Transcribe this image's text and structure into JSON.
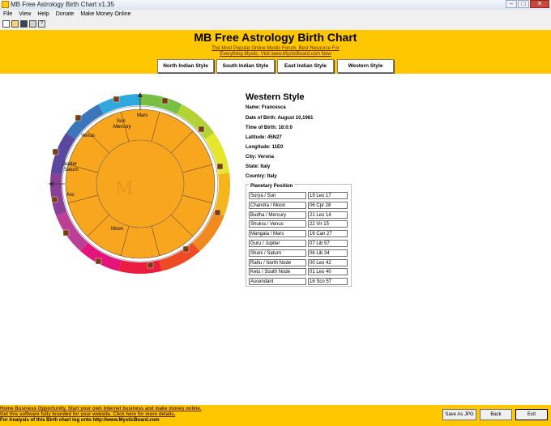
{
  "window": {
    "title": "MB Free Astrology Birth Chart v1.35"
  },
  "menu": [
    "File",
    "View",
    "Help",
    "Donate",
    "Make Money Online"
  ],
  "header": {
    "title": "MB Free Astrology Birth Chart",
    "sub1": "The Most Popular Online Mystic Forum. Best Resource For",
    "sub2": "Everything Mystic. Visit www.MysticBoard.com Now"
  },
  "tabs": [
    "North Indian Style",
    "South Indian Style",
    "East Indian Style",
    "Western Style"
  ],
  "chart": {
    "watermark": "M",
    "houses": {
      "sun_mercury": [
        "Sun",
        "Mercury"
      ],
      "venus": "Venus",
      "mars": "Mars",
      "jupiter_saturn": [
        "Jupiter",
        "Saturn"
      ],
      "asc": "Asc",
      "moon": "Moon"
    },
    "ring_colors": [
      "#77c043",
      "#b3d334",
      "#e6e72b",
      "#f6b51a",
      "#f18a1e",
      "#ee4a24",
      "#ea1c3f",
      "#e4147c",
      "#bd3e95",
      "#8a3f98",
      "#5a48a0",
      "#3b75bb",
      "#2fa8de"
    ]
  },
  "details": {
    "title": "Western Style",
    "name": "Name: Francesca",
    "dob": "Date of Birth: August 10,1981",
    "tob": "Time of Birth: 18:0:0",
    "lat": "Latitude: 45N27",
    "lon": "Longitude: 11E0",
    "city": "City: Verona",
    "state": "State: Italy",
    "country": "Country: Italy"
  },
  "planetary": {
    "legend": "Planetary Position",
    "rows": [
      [
        "Surya / Sun",
        "19 Leo 17"
      ],
      [
        "Chandra / Moon",
        "06 Cpr 28"
      ],
      [
        "Budha / Mercury",
        "21 Leo 14"
      ],
      [
        "Shukra / Venus",
        "22 Vir 15"
      ],
      [
        "Mangala / Mars",
        "16 Can 27"
      ],
      [
        "Guru / Jupiter",
        "07 Lib 57"
      ],
      [
        "Shani / Saturn",
        "06 Lib 34"
      ],
      [
        "Rahu / North Node",
        "00 Leo 42"
      ],
      [
        "Ketu / South Node",
        "01 Leo 40"
      ],
      [
        "Ascendant",
        "16 Sco 57"
      ]
    ]
  },
  "status": {
    "line1": "Home Business Opportunity. Start your own Internet business and make money online.",
    "line2": "Get this software fully branded for your website. Click here for more details.",
    "line3": "For Analysis of this Birth chart log onto http://www.MysticBoard.com"
  },
  "buttons": {
    "save": "Save As JPG",
    "back": "Back",
    "exit": "Exit"
  }
}
